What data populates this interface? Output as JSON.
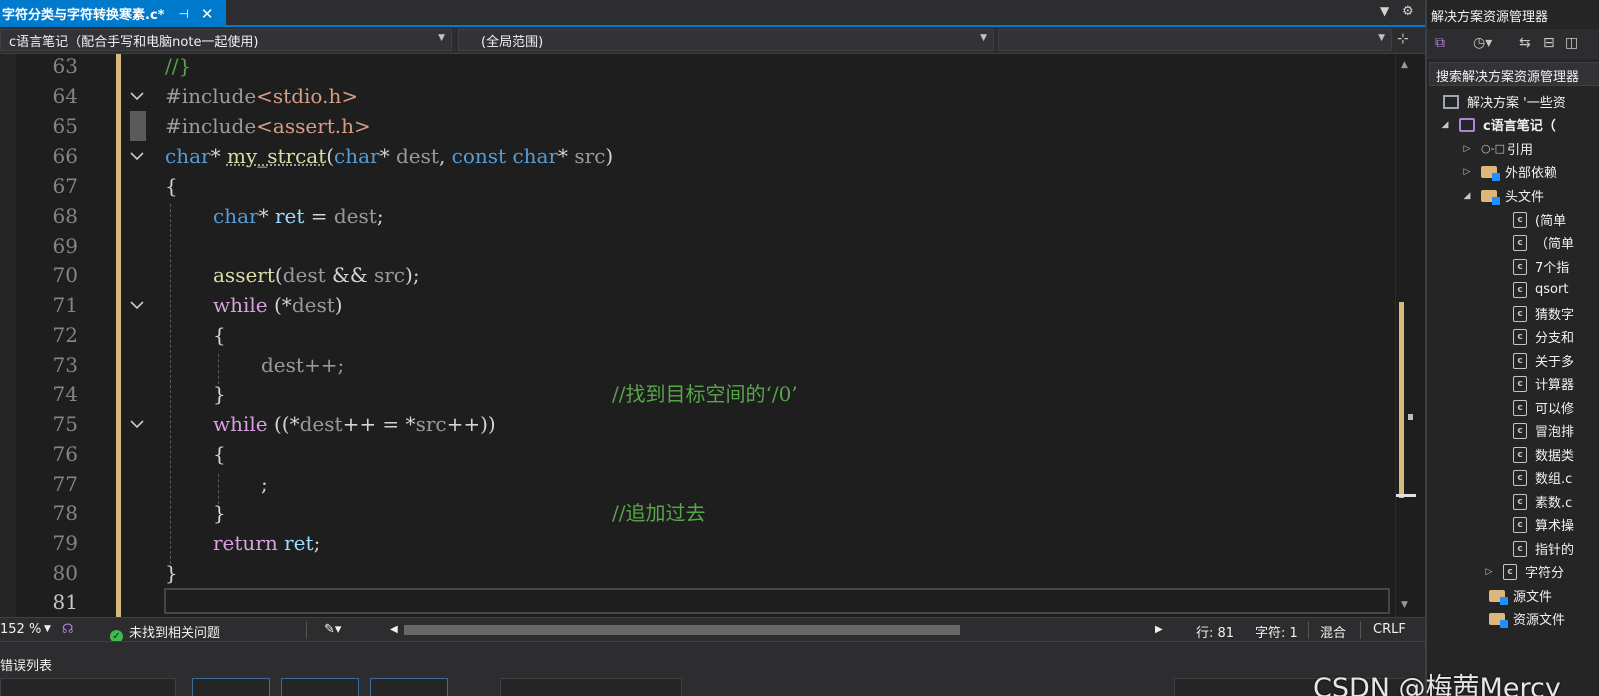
{
  "tab": {
    "title": "字符分类与字符转换寒素.c*",
    "pin": "⊣",
    "close": "✕"
  },
  "navbar": {
    "project": "c语言笔记（配合手写和电脑note一起使用)",
    "scope": "(全局范围)",
    "member": ""
  },
  "code_lines": [
    {
      "num": "63",
      "text": "//}"
    },
    {
      "num": "64",
      "text": "#include<stdio.h>"
    },
    {
      "num": "65",
      "text": "#include<assert.h>"
    },
    {
      "num": "66",
      "text": "char* my_strcat(char* dest, const char* src)"
    },
    {
      "num": "67",
      "text": "{"
    },
    {
      "num": "68",
      "text": "char* ret = dest;"
    },
    {
      "num": "69",
      "text": ""
    },
    {
      "num": "70",
      "text": "assert(dest && src);"
    },
    {
      "num": "71",
      "text": "while (*dest)"
    },
    {
      "num": "72",
      "text": "{"
    },
    {
      "num": "73",
      "text": "dest++;"
    },
    {
      "num": "74",
      "text": "}"
    },
    {
      "num": "75",
      "text": "while ((*dest++ = *src++))"
    },
    {
      "num": "76",
      "text": "{"
    },
    {
      "num": "77",
      "text": ";"
    },
    {
      "num": "78",
      "text": "}"
    },
    {
      "num": "79",
      "text": "return ret;"
    },
    {
      "num": "80",
      "text": "}"
    },
    {
      "num": "81",
      "text": ""
    }
  ],
  "comments": {
    "line74": "//找到目标空间的‘/0’",
    "line78": "//追加过去"
  },
  "status": {
    "zoom": "152 %",
    "problems": "未找到相关问题",
    "line": "行: 81",
    "char": "字符: 1",
    "mixed": "混合",
    "eol": "CRLF"
  },
  "bottom_panel": {
    "title": "错误列表"
  },
  "solution_explorer": {
    "title": "解决方案资源管理器",
    "search_placeholder": "搜索解决方案资源管理器",
    "solution": "解决方案 '一些资",
    "project": "c语言笔记（",
    "references": "引用",
    "external": "外部依赖",
    "headers": "头文件",
    "files": [
      "(简单",
      "（简单",
      "7个指",
      "qsort",
      "猜数字",
      "分支和",
      "关于多",
      "计算器",
      "可以修",
      "冒泡排",
      "数据类",
      "数组.c",
      "素数.c",
      "算术操",
      "指针的",
      "字符分"
    ],
    "source": "源文件",
    "resources": "资源文件"
  },
  "watermark": "CSDN @梅茜Mercy",
  "colors": {
    "accent": "#007acc",
    "keyword": "#569cd6",
    "control": "#d8a0df",
    "function": "#dcdcaa",
    "comment": "#57a64a",
    "include": "#d69d85",
    "change_marker": "#d7ba7d"
  }
}
